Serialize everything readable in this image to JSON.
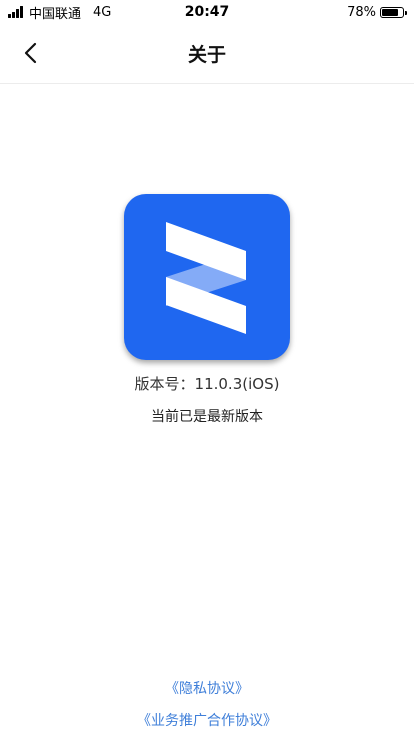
{
  "status_bar": {
    "carrier": "中国联通",
    "network": "4G",
    "time": "20:47",
    "battery_percent_text": "78%",
    "battery_level": 0.78
  },
  "nav": {
    "title": "关于",
    "back_icon": "chevron-left-icon"
  },
  "app": {
    "icon_name": "app-logo-icon",
    "icon_color": "#1f67f0",
    "version": "版本号：11.0.3(iOS)",
    "update_status": "当前已是最新版本"
  },
  "links": {
    "privacy": "《隐私协议》",
    "promotion": "《业务推广合作协议》",
    "color": "#3f7fd9"
  }
}
